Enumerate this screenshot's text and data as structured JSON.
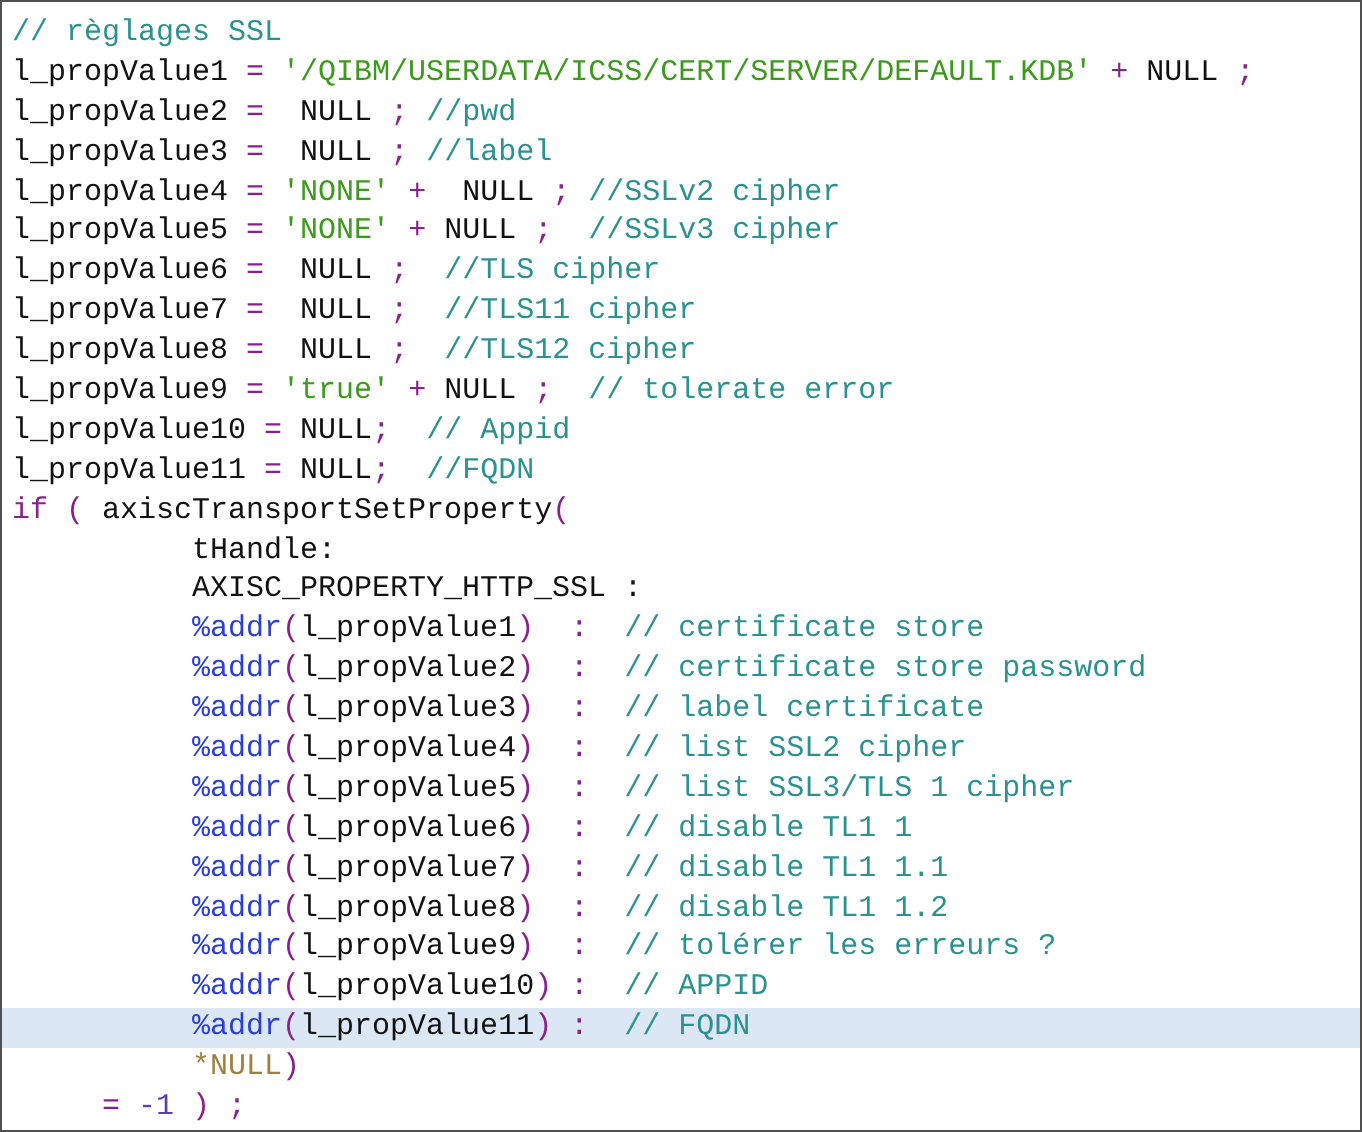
{
  "editor": {
    "lines": [
      {
        "current": false,
        "tokens": [
          {
            "kind": "comment",
            "text": "// règlages SSL"
          }
        ]
      },
      {
        "current": false,
        "tokens": [
          {
            "kind": "text",
            "text": "l_propValue1 "
          },
          {
            "kind": "punct",
            "text": "= "
          },
          {
            "kind": "string",
            "text": "'/QIBM/USERDATA/ICSS/CERT/SERVER/DEFAULT.KDB' "
          },
          {
            "kind": "punct",
            "text": "+ "
          },
          {
            "kind": "text",
            "text": "NULL "
          },
          {
            "kind": "punct",
            "text": ";"
          }
        ]
      },
      {
        "current": false,
        "tokens": [
          {
            "kind": "text",
            "text": "l_propValue2 "
          },
          {
            "kind": "punct",
            "text": "= "
          },
          {
            "kind": "text",
            "text": " NULL "
          },
          {
            "kind": "punct",
            "text": "; "
          },
          {
            "kind": "comment",
            "text": "//pwd"
          }
        ]
      },
      {
        "current": false,
        "tokens": [
          {
            "kind": "text",
            "text": "l_propValue3 "
          },
          {
            "kind": "punct",
            "text": "= "
          },
          {
            "kind": "text",
            "text": " NULL "
          },
          {
            "kind": "punct",
            "text": "; "
          },
          {
            "kind": "comment",
            "text": "//label"
          }
        ]
      },
      {
        "current": false,
        "tokens": [
          {
            "kind": "text",
            "text": "l_propValue4 "
          },
          {
            "kind": "punct",
            "text": "= "
          },
          {
            "kind": "string",
            "text": "'NONE' "
          },
          {
            "kind": "punct",
            "text": "+  "
          },
          {
            "kind": "text",
            "text": "NULL "
          },
          {
            "kind": "punct",
            "text": "; "
          },
          {
            "kind": "comment",
            "text": "//SSLv2 cipher"
          }
        ]
      },
      {
        "current": false,
        "tokens": [
          {
            "kind": "text",
            "text": "l_propValue5 "
          },
          {
            "kind": "punct",
            "text": "= "
          },
          {
            "kind": "string",
            "text": "'NONE' "
          },
          {
            "kind": "punct",
            "text": "+ "
          },
          {
            "kind": "text",
            "text": "NULL "
          },
          {
            "kind": "punct",
            "text": ";  "
          },
          {
            "kind": "comment",
            "text": "//SSLv3 cipher"
          }
        ]
      },
      {
        "current": false,
        "tokens": [
          {
            "kind": "text",
            "text": "l_propValue6 "
          },
          {
            "kind": "punct",
            "text": "= "
          },
          {
            "kind": "text",
            "text": " NULL "
          },
          {
            "kind": "punct",
            "text": ";  "
          },
          {
            "kind": "comment",
            "text": "//TLS cipher"
          }
        ]
      },
      {
        "current": false,
        "tokens": [
          {
            "kind": "text",
            "text": "l_propValue7 "
          },
          {
            "kind": "punct",
            "text": "= "
          },
          {
            "kind": "text",
            "text": " NULL "
          },
          {
            "kind": "punct",
            "text": ";  "
          },
          {
            "kind": "comment",
            "text": "//TLS11 cipher"
          }
        ]
      },
      {
        "current": false,
        "tokens": [
          {
            "kind": "text",
            "text": "l_propValue8 "
          },
          {
            "kind": "punct",
            "text": "= "
          },
          {
            "kind": "text",
            "text": " NULL "
          },
          {
            "kind": "punct",
            "text": ";  "
          },
          {
            "kind": "comment",
            "text": "//TLS12 cipher"
          }
        ]
      },
      {
        "current": false,
        "tokens": [
          {
            "kind": "text",
            "text": "l_propValue9 "
          },
          {
            "kind": "punct",
            "text": "= "
          },
          {
            "kind": "string",
            "text": "'true' "
          },
          {
            "kind": "punct",
            "text": "+ "
          },
          {
            "kind": "text",
            "text": "NULL "
          },
          {
            "kind": "punct",
            "text": ";  "
          },
          {
            "kind": "comment",
            "text": "// tolerate error"
          }
        ]
      },
      {
        "current": false,
        "tokens": [
          {
            "kind": "text",
            "text": "l_propValue10 "
          },
          {
            "kind": "punct",
            "text": "= "
          },
          {
            "kind": "text",
            "text": "NULL"
          },
          {
            "kind": "punct",
            "text": ";  "
          },
          {
            "kind": "comment",
            "text": "// Appid"
          }
        ]
      },
      {
        "current": false,
        "tokens": [
          {
            "kind": "text",
            "text": "l_propValue11 "
          },
          {
            "kind": "punct",
            "text": "= "
          },
          {
            "kind": "text",
            "text": "NULL"
          },
          {
            "kind": "punct",
            "text": ";  "
          },
          {
            "kind": "comment",
            "text": "//FQDN"
          }
        ]
      },
      {
        "current": false,
        "tokens": [
          {
            "kind": "keyword",
            "text": "if"
          },
          {
            "kind": "punct",
            "text": " ( "
          },
          {
            "kind": "text",
            "text": "axiscTransportSetProperty"
          },
          {
            "kind": "punct",
            "text": "("
          }
        ]
      },
      {
        "current": false,
        "tokens": [
          {
            "kind": "text",
            "text": "          tHandle:"
          }
        ]
      },
      {
        "current": false,
        "tokens": [
          {
            "kind": "text",
            "text": "          AXISC_PROPERTY_HTTP_SSL :"
          }
        ]
      },
      {
        "current": false,
        "tokens": [
          {
            "kind": "builtin",
            "text": "          %addr"
          },
          {
            "kind": "punct",
            "text": "("
          },
          {
            "kind": "text",
            "text": "l_propValue1"
          },
          {
            "kind": "punct",
            "text": ")  :  "
          },
          {
            "kind": "comment",
            "text": "// certificate store"
          }
        ]
      },
      {
        "current": false,
        "tokens": [
          {
            "kind": "builtin",
            "text": "          %addr"
          },
          {
            "kind": "punct",
            "text": "("
          },
          {
            "kind": "text",
            "text": "l_propValue2"
          },
          {
            "kind": "punct",
            "text": ")  :  "
          },
          {
            "kind": "comment",
            "text": "// certificate store password"
          }
        ]
      },
      {
        "current": false,
        "tokens": [
          {
            "kind": "builtin",
            "text": "          %addr"
          },
          {
            "kind": "punct",
            "text": "("
          },
          {
            "kind": "text",
            "text": "l_propValue3"
          },
          {
            "kind": "punct",
            "text": ")  :  "
          },
          {
            "kind": "comment",
            "text": "// label certificate"
          }
        ]
      },
      {
        "current": false,
        "tokens": [
          {
            "kind": "builtin",
            "text": "          %addr"
          },
          {
            "kind": "punct",
            "text": "("
          },
          {
            "kind": "text",
            "text": "l_propValue4"
          },
          {
            "kind": "punct",
            "text": ")  :  "
          },
          {
            "kind": "comment",
            "text": "// list SSL2 cipher"
          }
        ]
      },
      {
        "current": false,
        "tokens": [
          {
            "kind": "builtin",
            "text": "          %addr"
          },
          {
            "kind": "punct",
            "text": "("
          },
          {
            "kind": "text",
            "text": "l_propValue5"
          },
          {
            "kind": "punct",
            "text": ")  :  "
          },
          {
            "kind": "comment",
            "text": "// list SSL3/TLS 1 cipher"
          }
        ]
      },
      {
        "current": false,
        "tokens": [
          {
            "kind": "builtin",
            "text": "          %addr"
          },
          {
            "kind": "punct",
            "text": "("
          },
          {
            "kind": "text",
            "text": "l_propValue6"
          },
          {
            "kind": "punct",
            "text": ")  :  "
          },
          {
            "kind": "comment",
            "text": "// disable TL1 1"
          }
        ]
      },
      {
        "current": false,
        "tokens": [
          {
            "kind": "builtin",
            "text": "          %addr"
          },
          {
            "kind": "punct",
            "text": "("
          },
          {
            "kind": "text",
            "text": "l_propValue7"
          },
          {
            "kind": "punct",
            "text": ")  :  "
          },
          {
            "kind": "comment",
            "text": "// disable TL1 1.1"
          }
        ]
      },
      {
        "current": false,
        "tokens": [
          {
            "kind": "builtin",
            "text": "          %addr"
          },
          {
            "kind": "punct",
            "text": "("
          },
          {
            "kind": "text",
            "text": "l_propValue8"
          },
          {
            "kind": "punct",
            "text": ")  :  "
          },
          {
            "kind": "comment",
            "text": "// disable TL1 1.2"
          }
        ]
      },
      {
        "current": false,
        "tokens": [
          {
            "kind": "builtin",
            "text": "          %addr"
          },
          {
            "kind": "punct",
            "text": "("
          },
          {
            "kind": "text",
            "text": "l_propValue9"
          },
          {
            "kind": "punct",
            "text": ")  :  "
          },
          {
            "kind": "comment",
            "text": "// tolérer les erreurs ?"
          }
        ]
      },
      {
        "current": false,
        "tokens": [
          {
            "kind": "builtin",
            "text": "          %addr"
          },
          {
            "kind": "punct",
            "text": "("
          },
          {
            "kind": "text",
            "text": "l_propValue10"
          },
          {
            "kind": "punct",
            "text": ") :  "
          },
          {
            "kind": "comment",
            "text": "// APPID"
          }
        ]
      },
      {
        "current": true,
        "tokens": [
          {
            "kind": "builtin",
            "text": "          %addr"
          },
          {
            "kind": "punct",
            "text": "("
          },
          {
            "kind": "text",
            "text": "l_propValue11"
          },
          {
            "kind": "punct",
            "text": ") :  "
          },
          {
            "kind": "comment",
            "text": "// FQDN"
          }
        ]
      },
      {
        "current": false,
        "tokens": [
          {
            "kind": "special",
            "text": "          *NULL"
          },
          {
            "kind": "punct",
            "text": ")"
          }
        ]
      },
      {
        "current": false,
        "tokens": [
          {
            "kind": "punct",
            "text": "     = "
          },
          {
            "kind": "number",
            "text": "-1"
          },
          {
            "kind": "punct",
            "text": " ) ;"
          }
        ]
      }
    ]
  }
}
